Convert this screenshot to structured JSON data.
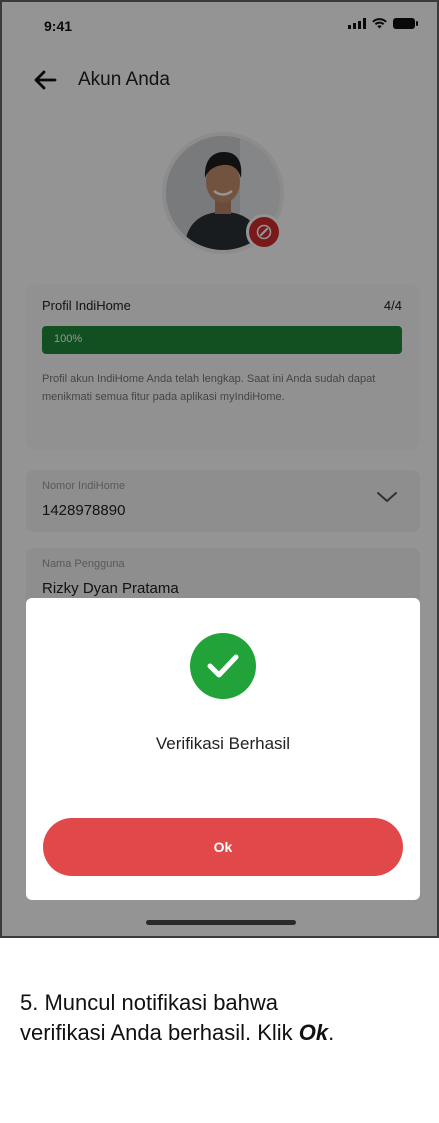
{
  "status_bar": {
    "time": "9:41"
  },
  "header": {
    "title": "Akun Anda",
    "back_icon": "arrow-left-icon"
  },
  "profile_card": {
    "title": "Profil IndiHome",
    "count": "4/4",
    "progress_label": "100%",
    "progress_fraction": 1.0,
    "description": "Profil akun IndiHome Anda telah lengkap. Saat ini Anda sudah dapat menikmati semua fitur pada aplikasi myIndiHome."
  },
  "fields": {
    "indihome_number": {
      "label": "Nomor IndiHome",
      "value": "1428978890"
    },
    "username": {
      "label": "Nama Pengguna",
      "value": "Rizky Dyan Pratama"
    }
  },
  "modal": {
    "title": "Verifikasi Berhasil",
    "ok_label": "Ok",
    "icon": "check-circle-icon"
  },
  "caption": {
    "line1": "5. Muncul notifikasi bahwa",
    "line2_prefix": "verifikasi Anda berhasil. Klik ",
    "line2_bold": "Ok",
    "line2_suffix": "."
  },
  "colors": {
    "accent_red": "#e0484a",
    "success_green": "#22a33a",
    "progress_green": "#1f8a3c"
  }
}
